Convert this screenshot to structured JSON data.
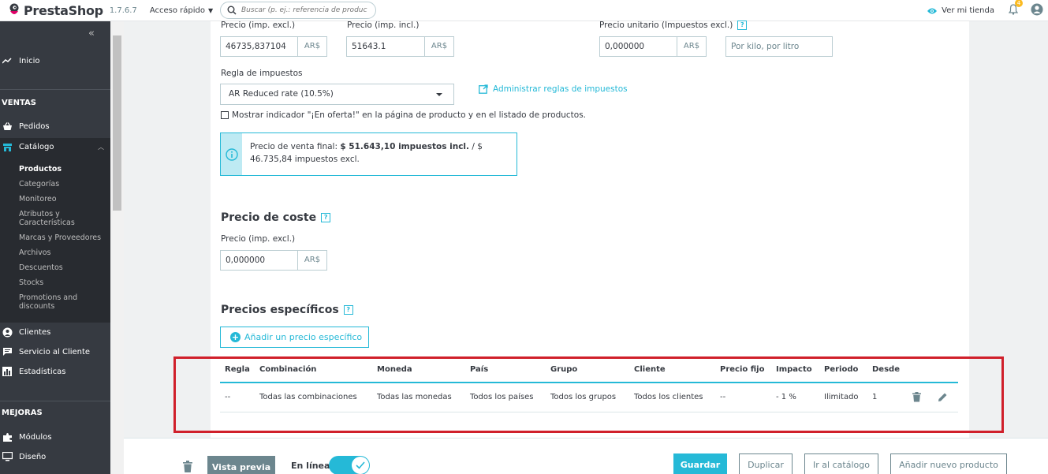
{
  "header": {
    "brand": "PrestaShop",
    "version": "1.7.6.7",
    "quick_access": "Acceso rápido",
    "search_placeholder": "Buscar (p. ej.: referencia de producto, no",
    "view_store": "Ver mi tienda",
    "notifications_count": "4"
  },
  "sidebar": {
    "inicio": "Inicio",
    "ventas_title": "VENTAS",
    "pedidos": "Pedidos",
    "catalogo": "Catálogo",
    "catalog_sub": [
      "Productos",
      "Categorías",
      "Monitoreo",
      "Atributos y Características",
      "Marcas y Proveedores",
      "Archivos",
      "Descuentos",
      "Stocks",
      "Promotions and discounts"
    ],
    "clientes": "Clientes",
    "servicio": "Servicio al Cliente",
    "estadisticas": "Estadísticas",
    "mejoras_title": "MEJORAS",
    "modulos": "Módulos",
    "diseno": "Diseño"
  },
  "pricing": {
    "price_excl_label": "Precio (imp. excl.)",
    "price_excl_value": "46735,837104",
    "price_incl_label": "Precio (imp. incl.)",
    "price_incl_value": "51643.1",
    "currency": "AR$",
    "unit_price_label": "Precio unitario (Impuestos excl.)",
    "unit_price_value": "0,000000",
    "unit_placeholder": "Por kilo, por litro",
    "tax_rule_label": "Regla de impuestos",
    "tax_rule_value": "AR Reduced rate (10.5%)",
    "manage_tax_link": "Administrar reglas de impuestos",
    "on_sale_label": "Mostrar indicador \"¡En oferta!\" en la página de producto y en el listado de productos.",
    "final_price_prefix": "Precio de venta final: ",
    "final_price_incl": "$ 51.643,10 impuestos incl.",
    "final_price_excl": " / $ 46.735,84 impuestos excl."
  },
  "cost": {
    "title": "Precio de coste",
    "label": "Precio (imp. excl.)",
    "value": "0,000000"
  },
  "specific": {
    "title": "Precios específicos",
    "add_button": "Añadir un precio específico",
    "columns": [
      "Regla",
      "Combinación",
      "Moneda",
      "País",
      "Grupo",
      "Cliente",
      "Precio fijo",
      "Impacto",
      "Periodo",
      "Desde"
    ],
    "row": [
      "--",
      "Todas las combinaciones",
      "Todas las monedas",
      "Todos los países",
      "Todos los grupos",
      "Todos los clientes",
      "--",
      "- 1 %",
      "Ilimitado",
      "1"
    ]
  },
  "footer": {
    "preview": "Vista previa",
    "online": "En línea",
    "save": "Guardar",
    "duplicate": "Duplicar",
    "to_catalog": "Ir al catálogo",
    "add_new": "Añadir nuevo producto"
  },
  "colors": {
    "accent": "#25b9d7",
    "sidebar": "#363a41",
    "highlight": "#d0202b"
  }
}
